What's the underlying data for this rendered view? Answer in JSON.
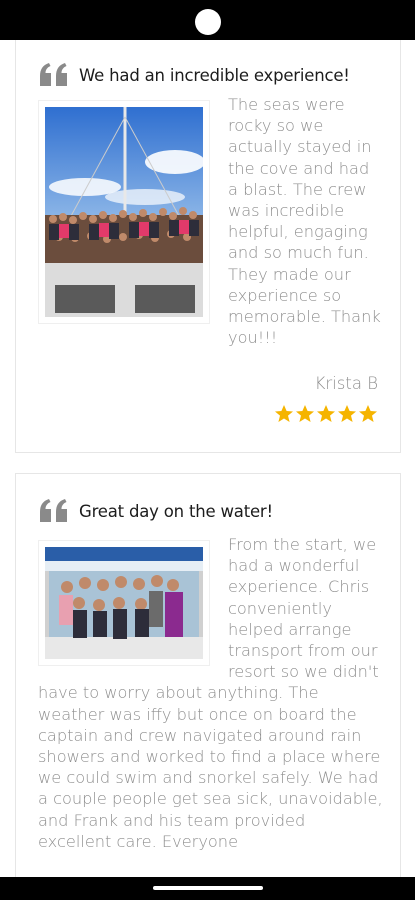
{
  "reviews": [
    {
      "title": "We had an incredible experience!",
      "body": "The seas were rocky so we actually stayed in the cove and had a blast. The crew was incredible helpful, engaging and so much fun. They made our experience so memorable. Thank you!!!",
      "author": "Krista B",
      "rating": 5,
      "photo_icon": "group-photo-on-boat-deck"
    },
    {
      "title": "Great day on the water!",
      "body": "From the start, we had a wonderful experience. Chris conveniently helped arrange transport from our resort so we didn't have to worry about anything. The weather was iffy but once on board the captain and crew navigated around rain showers and worked to find a place where we could swim and snorkel safely. We had a couple people get sea sick, unavoidable, and Frank and his team provided excellent care. Everyone",
      "photo_icon": "group-photo-under-boat-canopy"
    }
  ],
  "colors": {
    "star": "#f5b400",
    "quote_icon": "#8a8a8a",
    "body_text": "#8f8f8f",
    "title_text": "#1c1c1c"
  }
}
